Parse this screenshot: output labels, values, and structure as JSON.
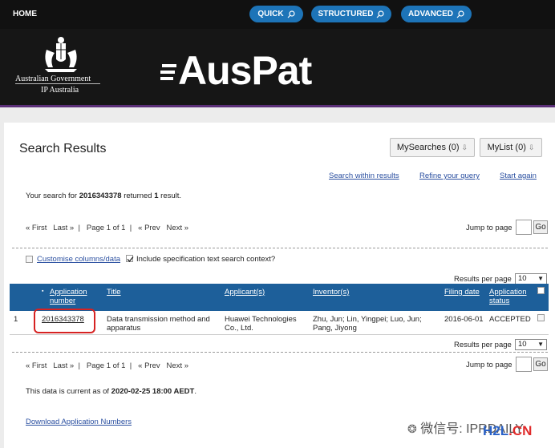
{
  "nav": {
    "home": "HOME",
    "quick": "QUICK",
    "structured": "STRUCTURED",
    "advanced": "ADVANCED"
  },
  "banner": {
    "gov_line1": "Australian Government",
    "gov_line2": "IP Australia",
    "logo": "AusPat"
  },
  "page": {
    "title": "Search Results",
    "mysearches": "MySearches (0)",
    "mylist": "MyList (0)",
    "links": {
      "within": "Search within results",
      "refine": "Refine your query",
      "start": "Start again"
    },
    "summary_pre": "Your search for ",
    "query": "2016343378",
    "summary_mid": " returned ",
    "count": "1",
    "summary_post": " result.",
    "pager": {
      "first": "« First",
      "last": "Last »",
      "page": "Page 1 of 1",
      "prev": "« Prev",
      "next": "Next »",
      "jump": "Jump to page",
      "go": "Go"
    },
    "customise": "Customise columns/data",
    "include_spec": "Include specification text search context?",
    "rpp_label": "Results per page",
    "rpp_value": "10",
    "columns": {
      "app_num_1": "Application",
      "app_num_2": "number",
      "title": "Title",
      "applicant": "Applicant(s)",
      "inventor": "Inventor(s)",
      "filing": "Filing date",
      "status_1": "Application",
      "status_2": "status"
    },
    "rows": [
      {
        "idx": "1",
        "number": "2016343378",
        "title_1": "Data transmission method and",
        "title_2": "apparatus",
        "applicant_1": "Huawei Technologies",
        "applicant_2": "Co., Ltd.",
        "inventor_1": "Zhu, Jun; Lin, Yingpei; Luo, Jun;",
        "inventor_2": "Pang, Jiyong",
        "filing": "2016-06-01",
        "status": "ACCEPTED"
      }
    ],
    "current_pre": "This data is current as of ",
    "current_date": "2020-02-25 18:00 AEDT",
    "current_post": ".",
    "download": "Download Application Numbers"
  },
  "watermark": {
    "wechat": "微信号: IPRDAILY",
    "site_a": "H2L",
    "site_b": ".CN"
  },
  "colors": {
    "nav_pill": "#1d74b8",
    "table_header": "#1d5f9a",
    "banner_border": "#5b2f78",
    "link": "#2a4fa0",
    "highlight": "#d62222"
  }
}
